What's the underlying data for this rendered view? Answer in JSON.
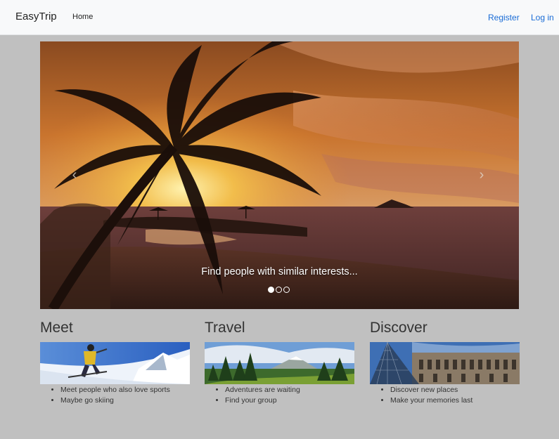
{
  "navbar": {
    "brand": "EasyTrip",
    "home": "Home",
    "register": "Register",
    "login": "Log in"
  },
  "carousel": {
    "caption": "Find people with similar interests...",
    "slide_count": 3,
    "active_slide": 1,
    "prev_icon": "chevron-left-icon",
    "next_icon": "chevron-right-icon"
  },
  "features": [
    {
      "title": "Meet",
      "items": [
        "Meet people who also love sports",
        "Maybe go skiing"
      ]
    },
    {
      "title": "Travel",
      "items": [
        "Adventures are waiting",
        "Find your group"
      ]
    },
    {
      "title": "Discover",
      "items": [
        "Discover new places",
        "Make your memories last"
      ]
    }
  ],
  "colors": {
    "page_bg": "#c0c0c0",
    "navbar_bg": "#f8f9fa",
    "link": "#1a6cd6"
  }
}
